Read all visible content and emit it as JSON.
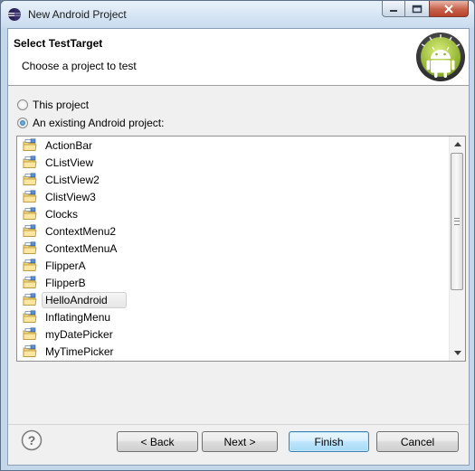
{
  "window": {
    "title": "New Android Project"
  },
  "banner": {
    "title": "Select TestTarget",
    "subtitle": "Choose a project to test"
  },
  "options": {
    "this_project": "This project",
    "existing_project": "An existing Android project:",
    "selected": "existing_project"
  },
  "projects": [
    "ActionBar",
    "CListView",
    "CListView2",
    "ClistView3",
    "Clocks",
    "ContextMenu2",
    "ContextMenuA",
    "FlipperA",
    "FlipperB",
    "HelloAndroid",
    "InflatingMenu",
    "myDatePicker",
    "MyTimePicker"
  ],
  "selected_project": "HelloAndroid",
  "buttons": {
    "back": "< Back",
    "next": "Next >",
    "finish": "Finish",
    "cancel": "Cancel"
  },
  "colors": {
    "android_green": "#a4c639",
    "default_button": "#3c7fb1"
  }
}
